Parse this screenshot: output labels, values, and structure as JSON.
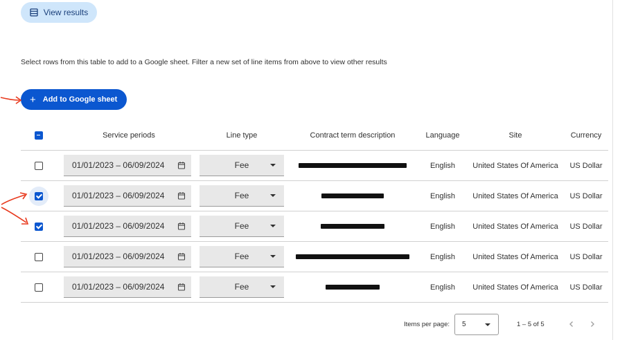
{
  "toolbar": {
    "view_results_label": "View results"
  },
  "description": "Select rows from this table to add to a Google sheet. Filter a new set of line items from above to view other results",
  "add_button": {
    "label": "Add to Google sheet",
    "icon": "plus-icon"
  },
  "table": {
    "select_all_state": "indeterminate",
    "columns": [
      "Service periods",
      "Line type",
      "Contract term description",
      "Language",
      "Site",
      "Currency"
    ],
    "rows": [
      {
        "checked": false,
        "service_period": "01/01/2023 – 06/09/2024",
        "line_type": "Fee",
        "contract_term": "[redacted]",
        "language": "English",
        "site": "United States Of America",
        "currency": "US Dollar"
      },
      {
        "checked": true,
        "service_period": "01/01/2023 – 06/09/2024",
        "line_type": "Fee",
        "contract_term": "[redacted]",
        "language": "English",
        "site": "United States Of America",
        "currency": "US Dollar"
      },
      {
        "checked": true,
        "service_period": "01/01/2023 – 06/09/2024",
        "line_type": "Fee",
        "contract_term": "[redacted]",
        "language": "English",
        "site": "United States Of America",
        "currency": "US Dollar"
      },
      {
        "checked": false,
        "service_period": "01/01/2023 – 06/09/2024",
        "line_type": "Fee",
        "contract_term": "[redacted]",
        "language": "English",
        "site": "United States Of America",
        "currency": "US Dollar"
      },
      {
        "checked": false,
        "service_period": "01/01/2023 – 06/09/2024",
        "line_type": "Fee",
        "contract_term": "[redacted]",
        "language": "English",
        "site": "United States Of America",
        "currency": "US Dollar"
      }
    ]
  },
  "pagination": {
    "items_per_page_label": "Items per page:",
    "items_per_page_value": "5",
    "range_label": "1 – 5 of 5"
  },
  "colors": {
    "primary": "#0b57d0",
    "tonal": "#cfe6fb",
    "annotation_arrow": "#e8391d",
    "field_bg": "#e8e8e8"
  }
}
